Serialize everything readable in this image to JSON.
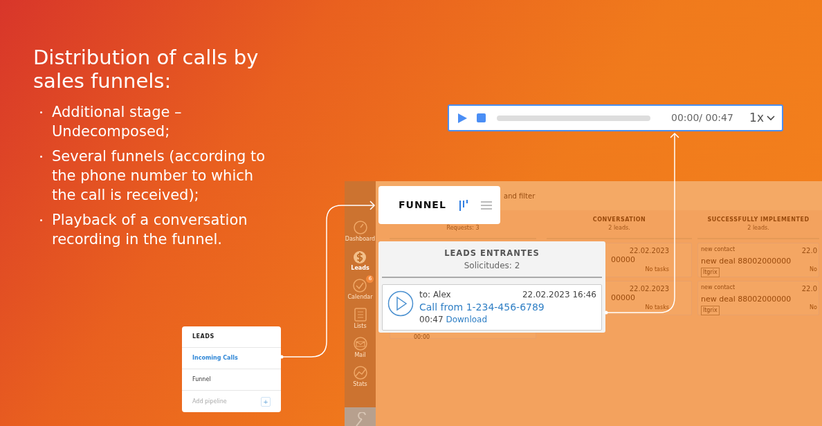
{
  "slide": {
    "title": "Distribution of calls by sales funnels:",
    "bullets": [
      "Additional stage – Undecomposed;",
      "Several funnels (according to the phone number to which the call is received);",
      "Playback of a conversation recording in the funnel."
    ]
  },
  "player": {
    "level": 0,
    "time": "00:00/ 00:47",
    "speed": "1x"
  },
  "background_app": {
    "search_hint": "and filter",
    "sidebar": [
      {
        "kind": "gauge",
        "label": "Dashboard",
        "selected": false
      },
      {
        "kind": "dollar",
        "label": "Leads",
        "selected": true
      },
      {
        "kind": "check",
        "label": "Calendar",
        "selected": false,
        "badge": "6"
      },
      {
        "kind": "list",
        "label": "Lists",
        "selected": false
      },
      {
        "kind": "mail",
        "label": "Mail",
        "selected": false
      },
      {
        "kind": "chart",
        "label": "Stats",
        "selected": false
      }
    ],
    "columns": [
      {
        "count": "Requests: 3",
        "cards": [
          {
            "time": "00:00"
          }
        ]
      },
      {
        "title": "CONVERSATION",
        "count": "2 leads.",
        "cards": [
          {
            "date": "22.02.2023",
            "deal": "00000",
            "tasks": "No tasks"
          },
          {
            "date": "22.02.2023",
            "deal": "00000",
            "tasks": "No tasks"
          }
        ]
      },
      {
        "title": "SUCCESSFULLY IMPLEMENTED",
        "count": "2 leads.",
        "cards": [
          {
            "contact": "new contact",
            "date": "22.0",
            "deal": "new deal 88002000000",
            "tag": "ltgrix",
            "tasks": "No"
          },
          {
            "contact": "new contact",
            "date": "22.0",
            "deal": "new deal 88002000000",
            "tag": "ltgrix",
            "tasks": "No"
          }
        ]
      }
    ]
  },
  "funnel_card": {
    "title": "FUNNEL"
  },
  "incoming_panel": {
    "title": "LEADS ENTRANTES",
    "count": "Solicitudes: 2",
    "call": {
      "to_label": "to:",
      "to": "Alex",
      "datetime": "22.02.2023 16:46",
      "call_from": "Call from",
      "phone": "1-234-456-6789",
      "duration": "00:47",
      "download": "Download"
    }
  },
  "leads_menu": {
    "title": "LEADS",
    "items": [
      {
        "label": "Incoming Calls",
        "selected": true
      },
      {
        "label": "Funnel",
        "selected": false
      }
    ],
    "add_label": "Add pipeline",
    "add_button": "+"
  }
}
